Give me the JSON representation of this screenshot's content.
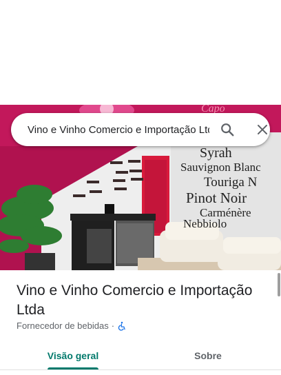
{
  "search": {
    "query": "Vino e Vinho Comercio e Importação Ltda",
    "search_icon": "search-icon",
    "clear_icon": "close-icon"
  },
  "place": {
    "name": "Vino e Vinho Comercio e Importação Ltda",
    "category": "Fornecedor de bebidas",
    "separator": "·",
    "accessibility_icon": "wheelchair-icon"
  },
  "photo": {
    "wall_words": [
      "Syrah",
      "Sauvignon Blanc",
      "Touriga N",
      "Pinot Noir",
      "Carménère",
      "Nebbiolo",
      "Capo"
    ]
  },
  "tabs": [
    {
      "label": "Visão geral",
      "active": true
    },
    {
      "label": "Sobre",
      "active": false
    }
  ],
  "colors": {
    "accent": "#00796b",
    "wall_magenta": "#c2185b",
    "door_red": "#d81b3c"
  }
}
